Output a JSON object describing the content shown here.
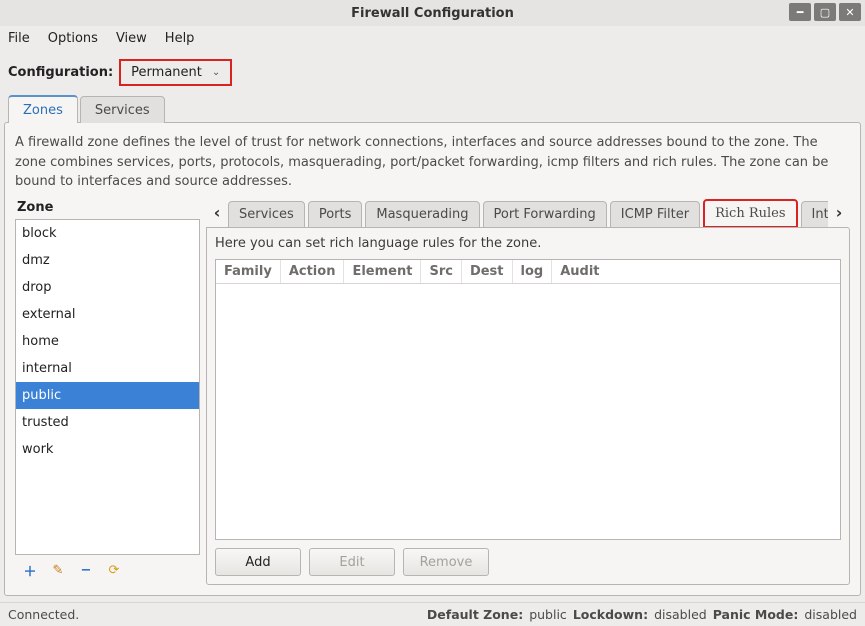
{
  "window": {
    "title": "Firewall Configuration"
  },
  "menubar": {
    "items": [
      "File",
      "Options",
      "View",
      "Help"
    ]
  },
  "config": {
    "label": "Configuration:",
    "value": "Permanent"
  },
  "main_tabs": {
    "items": [
      "Zones",
      "Services"
    ],
    "active": 0
  },
  "description": "A firewalld zone defines the level of trust for network connections, interfaces and source addresses bound to the zone. The zone combines services, ports, protocols, masquerading, port/packet forwarding, icmp filters and rich rules. The zone can be bound to interfaces and source addresses.",
  "zone": {
    "label": "Zone",
    "items": [
      "block",
      "dmz",
      "drop",
      "external",
      "home",
      "internal",
      "public",
      "trusted",
      "work"
    ],
    "selected": "public"
  },
  "sub_tabs": {
    "items": [
      "Services",
      "Ports",
      "Masquerading",
      "Port Forwarding",
      "ICMP Filter",
      "Rich Rules",
      "Interfaces"
    ],
    "active": 5
  },
  "detail": {
    "description": "Here you can set rich language rules for the zone.",
    "columns": [
      "Family",
      "Action",
      "Element",
      "Src",
      "Dest",
      "log",
      "Audit"
    ],
    "buttons": {
      "add": "Add",
      "edit": "Edit",
      "remove": "Remove"
    }
  },
  "status": {
    "left": "Connected.",
    "defzone_label": "Default Zone:",
    "defzone_value": "public",
    "lockdown_label": "Lockdown:",
    "lockdown_value": "disabled",
    "panic_label": "Panic Mode:",
    "panic_value": "disabled"
  }
}
